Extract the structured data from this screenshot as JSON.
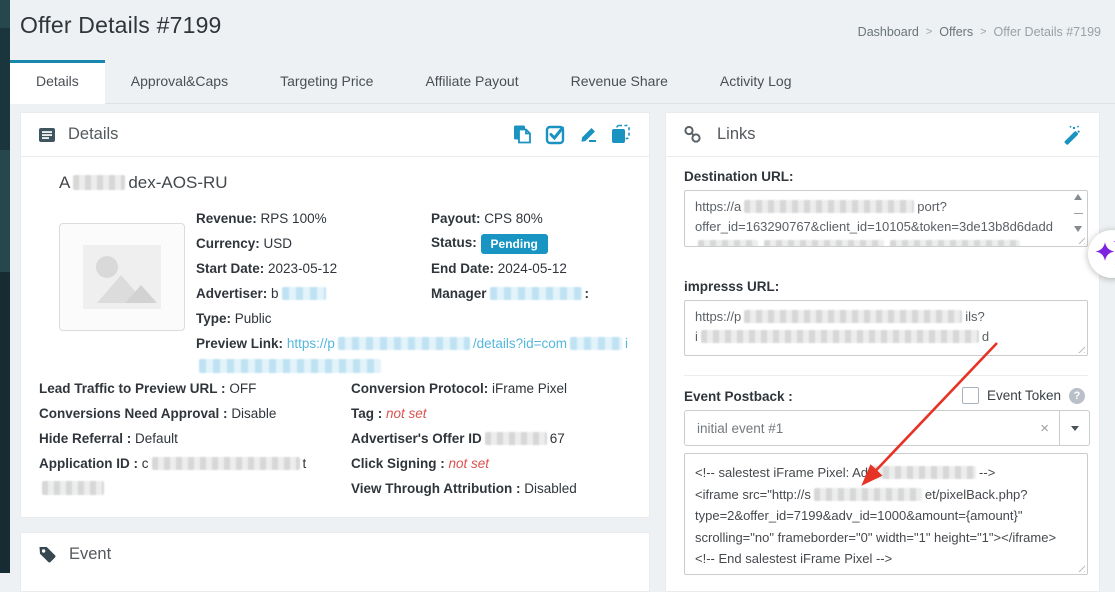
{
  "page": {
    "title": "Offer Details #7199",
    "breadcrumb": {
      "separator": ">",
      "items": [
        {
          "label": "Dashboard"
        },
        {
          "label": "Offers"
        },
        {
          "label": "Offer Details #7199"
        }
      ]
    }
  },
  "tabs": {
    "items": [
      {
        "label": "Details",
        "active": true
      },
      {
        "label": "Approval&Caps",
        "active": false
      },
      {
        "label": "Targeting Price",
        "active": false
      },
      {
        "label": "Affiliate Payout",
        "active": false
      },
      {
        "label": "Revenue Share",
        "active": false
      },
      {
        "label": "Activity Log",
        "active": false
      }
    ]
  },
  "details_panel": {
    "title": "Details",
    "header_icons": [
      "copy-offer-icon",
      "approve-offer-icon",
      "edit-offer-icon",
      "clone-offer-icon"
    ],
    "offer_name": {
      "prefix": "A",
      "suffix": "dex-AOS-RU"
    },
    "info": {
      "revenue": {
        "label": "Revenue:",
        "value": "RPS 100%"
      },
      "currency": {
        "label": "Currency:",
        "value": "USD"
      },
      "start_date": {
        "label": "Start Date:",
        "value": "2023-05-12"
      },
      "advertiser": {
        "label": "Advertiser:",
        "value_start": "b"
      },
      "type": {
        "label": "Type:",
        "value": "Public"
      },
      "preview_link": {
        "label": "Preview Link:",
        "start": "https://p",
        "mid": "/details?id=com",
        "end": "i"
      },
      "payout": {
        "label": "Payout:",
        "value": "CPS 80%"
      },
      "status": {
        "label": "Status:",
        "badge": "Pending"
      },
      "end_date": {
        "label": "End Date:",
        "value": "2024-05-12"
      },
      "manager": {
        "label": "Manager"
      }
    },
    "settings": {
      "lead_traffic": {
        "label": "Lead Traffic to Preview URL :",
        "value": "OFF"
      },
      "conversions_approval": {
        "label": "Conversions Need Approval :",
        "value": "Disable"
      },
      "hide_referral": {
        "label": "Hide Referral :",
        "value": "Default"
      },
      "application_id": {
        "label": "Application ID :",
        "value_start": "c",
        "value_end": "t"
      },
      "conversion_protocol": {
        "label": "Conversion Protocol:",
        "value": "iFrame Pixel"
      },
      "tag": {
        "label": "Tag :",
        "value": "not set"
      },
      "advertisers_offer_id": {
        "label": "Advertiser's Offer ID",
        "value_end": "67"
      },
      "click_signing": {
        "label": "Click Signing :",
        "value": "not set"
      },
      "view_through": {
        "label": "View Through Attribution :",
        "value": "Disabled"
      }
    }
  },
  "event_panel": {
    "title": "Event"
  },
  "links_panel": {
    "title": "Links",
    "header_icons": [
      "magic-wand-icon"
    ],
    "destination_url": {
      "label": "Destination URL:",
      "line1_start": "https://a",
      "line1_end": "port?",
      "line2": "offer_id=163290767&client_id=10105&token=3de13b8d6dadd"
    },
    "impress_url": {
      "label": "impresss URL:",
      "line1_start": "https://p",
      "line1_end": "ils?",
      "line2_start": "i",
      "line2_end": "d"
    },
    "event_postback": {
      "label": "Event Postback :",
      "token_label": "Event Token",
      "help_glyph": "?"
    },
    "event_select": {
      "value": "initial event #1",
      "clear_glyph": "×"
    },
    "pixel_code": {
      "line1_start": "<!-- salestest iFrame Pixel: Ad",
      "line1_end": "-->",
      "line2_start": "<iframe src=\"http://s",
      "line2_end": "et/pixelBack.php?",
      "line3": "type=2&offer_id=7199&adv_id=1000&amount={amount}\"",
      "line4": "scrolling=\"no\" frameborder=\"0\" width=\"1\" height=\"1\"></iframe>",
      "line5": "<!-- End salestest iFrame Pixel -->"
    }
  },
  "colors": {
    "accent_icon_blue": "#1a93c0",
    "active_tab_border": "#1787ad",
    "status_badge": "#1895c2",
    "link_blue": "#54b7dc",
    "error_red": "#d9534f",
    "arrow_red": "#e63325",
    "sparkle_purple": "#7d22e0"
  }
}
